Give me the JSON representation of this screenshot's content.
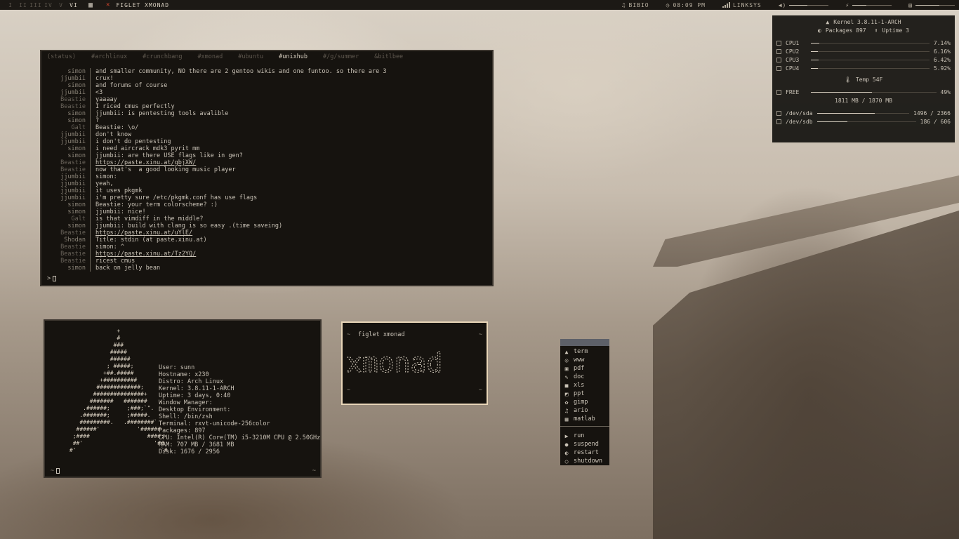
{
  "topbar": {
    "workspaces": [
      "I",
      "II",
      "III",
      "IV",
      "V",
      "VI"
    ],
    "active_workspace": "VI",
    "window_title": "FIGLET XMONAD",
    "music": "BIBIO",
    "clock": "08:09 PM",
    "wifi": "LINKSYS",
    "volume_level": 0.45,
    "brightness_level": 0.35,
    "battery_level": 0.6
  },
  "conky": {
    "kernel": "Kernel 3.8.11-1-ARCH",
    "packages": "Packages 897",
    "uptime": "Uptime 3",
    "cpus": [
      {
        "label": "CPU1",
        "value": "7.14%",
        "fraction": 0.0714
      },
      {
        "label": "CPU2",
        "value": "6.16%",
        "fraction": 0.0616
      },
      {
        "label": "CPU3",
        "value": "6.42%",
        "fraction": 0.0642
      },
      {
        "label": "CPU4",
        "value": "5.92%",
        "fraction": 0.0592
      }
    ],
    "temp": "Temp 54F",
    "free_label": "FREE",
    "free_value": "49%",
    "free_fraction": 0.49,
    "mem": "1811 MB / 1870 MB",
    "disks": [
      {
        "label": "/dev/sda",
        "value": "1496 / 2366",
        "fraction": 0.63
      },
      {
        "label": "/dev/sdb",
        "value": "186 / 606",
        "fraction": 0.31
      }
    ]
  },
  "irc": {
    "tabs": [
      "(status)",
      "#archlinux",
      "#crunchbang",
      "#xmonad",
      "#ubuntu",
      "#unixhub",
      "#/g/summer",
      "&bitlbee"
    ],
    "active_tab": "#unixhub",
    "lines": [
      {
        "nick": "simon",
        "msg": "and smaller community, NO there are 2 gentoo wikis and one funtoo. so there are 3"
      },
      {
        "nick": "jjumbii",
        "msg": "crux!"
      },
      {
        "nick": "simon",
        "msg": "and forums of course"
      },
      {
        "nick": "jjumbii",
        "msg": "<3"
      },
      {
        "nick": "Beastie",
        "msg": "yaaaay"
      },
      {
        "nick": "Beastie",
        "msg": "I riced cmus perfectly"
      },
      {
        "nick": "simon",
        "msg": "jjumbii: is pentesting tools avalible"
      },
      {
        "nick": "simon",
        "msg": "?"
      },
      {
        "nick": "Galt",
        "msg": "Beastie: \\o/"
      },
      {
        "nick": "jjumbii",
        "msg": "don't know"
      },
      {
        "nick": "jjumbii",
        "msg": "i don't do pentesting"
      },
      {
        "nick": "simon",
        "msg": "i need aircrack mdk3 pyrit mm"
      },
      {
        "nick": "simon",
        "msg": "jjumbii: are there USE flags like in gen?"
      },
      {
        "nick": "Beastie",
        "msg": "https://paste.xinu.at/gbjXW/",
        "link": true
      },
      {
        "nick": "Beastie",
        "msg": "now that's  a good looking music player"
      },
      {
        "nick": "jjumbii",
        "msg": "simon:"
      },
      {
        "nick": "jjumbii",
        "msg": "yeah,"
      },
      {
        "nick": "jjumbii",
        "msg": "it uses pkgmk"
      },
      {
        "nick": "jjumbii",
        "msg": "i'm pretty sure /etc/pkgmk.conf has use flags"
      },
      {
        "nick": "simon",
        "msg": "Beastie: your term colorscheme? :)"
      },
      {
        "nick": "simon",
        "msg": "jjumbii: nice!"
      },
      {
        "nick": "Galt",
        "msg": "is that vimdiff in the middle?"
      },
      {
        "nick": "simon",
        "msg": "jjumbii: build with clang is so easy .(time saveing)"
      },
      {
        "nick": "Beastie",
        "msg": "https://paste.xinu.at/uYlE/",
        "link": true
      },
      {
        "nick": "Shodan",
        "msg": "Title: stdin (at paste.xinu.at)"
      },
      {
        "nick": "Beastie",
        "msg": "simon: ^"
      },
      {
        "nick": "Beastie",
        "msg": "https://paste.xinu.at/Tz2YQ/",
        "link": true
      },
      {
        "nick": "Beastie",
        "msg": "ricest cmus"
      },
      {
        "nick": "simon",
        "msg": "back on jelly bean"
      }
    ],
    "prompt": ">"
  },
  "archey": {
    "logo": "                    +\n                    #\n                   ###\n                  #####\n                  ######\n                 ; #####;\n                +##.#####\n               +##########\n              #############;\n             ###############+\n            #######   #######\n          .######;     ;###;`\".\n         .#######;     ;#####.\n         #########.   .########`\n        ######'           '######\n       ;####                 ####;\n       ##'                     '##\n      #'                         `#",
    "info": [
      {
        "k": "User: ",
        "v": "sunn"
      },
      {
        "k": "Hostname: ",
        "v": "x230"
      },
      {
        "k": "Distro: ",
        "v": "Arch Linux"
      },
      {
        "k": "Kernel: ",
        "v": "3.8.11-1-ARCH"
      },
      {
        "k": "Uptime: ",
        "v": "3 days, 0:40"
      },
      {
        "k": "Window Manager: ",
        "v": ""
      },
      {
        "k": "Desktop Environment: ",
        "v": ""
      },
      {
        "k": "Shell: ",
        "v": "/bin/zsh"
      },
      {
        "k": "Terminal: ",
        "v": "rxvt-unicode-256color"
      },
      {
        "k": "Packages: ",
        "v": "897"
      },
      {
        "k": "CPU: ",
        "v": "Intel(R) Core(TM) i5-3210M CPU @ 2.50GHz"
      },
      {
        "k": "RAM: ",
        "v": "707 MB / 3681 MB"
      },
      {
        "k": "Disk: ",
        "v": "1676 / 2956"
      }
    ],
    "prompt_tilde": "~",
    "tilde": "~"
  },
  "figlet": {
    "tilde": "~",
    "command": "figlet xmonad",
    "art_text": "xmonad"
  },
  "menu": {
    "apps": [
      {
        "label": "term",
        "icon": "arch-icon"
      },
      {
        "label": "www",
        "icon": "globe-icon"
      },
      {
        "label": "pdf",
        "icon": "pdf-icon"
      },
      {
        "label": "doc",
        "icon": "doc-icon"
      },
      {
        "label": "xls",
        "icon": "xls-icon"
      },
      {
        "label": "ppt",
        "icon": "ppt-icon"
      },
      {
        "label": "gimp",
        "icon": "gimp-icon"
      },
      {
        "label": "ario",
        "icon": "music-note-icon"
      },
      {
        "label": "matlab",
        "icon": "matlab-icon"
      }
    ],
    "actions": [
      {
        "label": "run",
        "icon": "play-icon"
      },
      {
        "label": "suspend",
        "icon": "circle-filled-icon"
      },
      {
        "label": "restart",
        "icon": "half-circle-icon"
      },
      {
        "label": "shutdown",
        "icon": "circle-outline-icon"
      }
    ]
  }
}
